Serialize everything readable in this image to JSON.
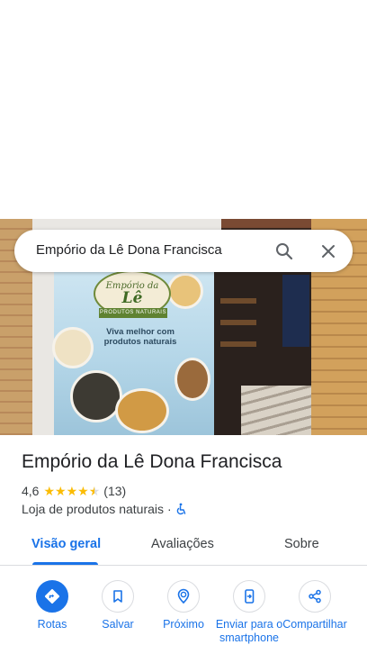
{
  "search": {
    "query": "Empório da Lê Dona Francisca"
  },
  "photo": {
    "logo_line1": "Empório da",
    "logo_line2": "Lê",
    "logo_ribbon": "PRODUTOS NATURAIS",
    "slogan": "Viva melhor com produtos naturais"
  },
  "place": {
    "name": "Empório da Lê Dona Francisca",
    "rating": "4,6",
    "rating_value": 4.6,
    "review_count": "(13)",
    "category": "Loja de produtos naturais",
    "separator": "·"
  },
  "tabs": [
    {
      "label": "Visão geral",
      "active": true
    },
    {
      "label": "Avaliações",
      "active": false
    },
    {
      "label": "Sobre",
      "active": false
    }
  ],
  "actions": [
    {
      "label": "Rotas",
      "icon": "directions-icon"
    },
    {
      "label": "Salvar",
      "icon": "bookmark-icon"
    },
    {
      "label": "Próximo",
      "icon": "nearby-icon"
    },
    {
      "label": "Enviar para o smartphone",
      "icon": "send-to-phone-icon"
    },
    {
      "label": "Compartilhar",
      "icon": "share-icon"
    }
  ],
  "colors": {
    "accent": "#1a73e8",
    "star": "#fbbc04",
    "text": "#202124",
    "muted": "#3c4043"
  }
}
